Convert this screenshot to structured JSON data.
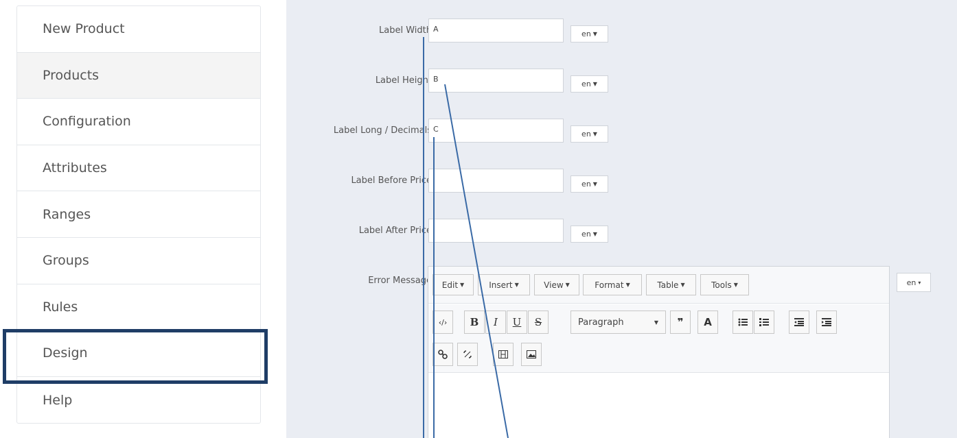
{
  "sidebar": {
    "items": [
      {
        "label": "New Product"
      },
      {
        "label": "Products"
      },
      {
        "label": "Configuration"
      },
      {
        "label": "Attributes"
      },
      {
        "label": "Ranges"
      },
      {
        "label": "Groups"
      },
      {
        "label": "Rules"
      },
      {
        "label": "Design"
      },
      {
        "label": "Help"
      }
    ]
  },
  "form": {
    "rows": [
      {
        "label": "Label Width",
        "value": "A",
        "lang": "en"
      },
      {
        "label": "Label Height",
        "value": "B",
        "lang": "en"
      },
      {
        "label": "Label Long / Decimals",
        "value": "C",
        "lang": "en"
      },
      {
        "label": "Label Before Price",
        "value": "",
        "lang": "en"
      },
      {
        "label": "Label After Price",
        "value": "",
        "lang": "en"
      }
    ],
    "error_label": "Error Message",
    "error_lang": "en"
  },
  "editor": {
    "menus": [
      "Edit",
      "Insert",
      "View",
      "Format",
      "Table",
      "Tools"
    ],
    "paragraph": "Paragraph",
    "tools": {
      "code": "‹/›",
      "bold": "B",
      "italic": "I",
      "underline": "U",
      "strike": "S",
      "quote": "❞",
      "color": "A"
    }
  },
  "colors": {
    "highlight": "#1f3d66",
    "annotation": "#3a6aa6",
    "panel": "#eaedf3"
  }
}
